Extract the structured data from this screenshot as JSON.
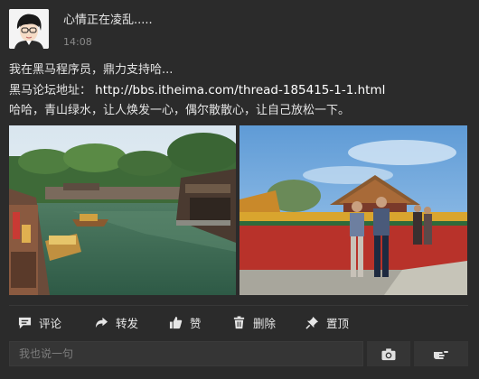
{
  "post": {
    "username": "心情正在凌乱.....",
    "time": "14:08",
    "line1": "我在黑马程序员，鼎力支持哈...",
    "line2_label": "黑马论坛地址：",
    "line2_url": "http://bbs.itheima.com/thread-185415-1-1.html",
    "line3": "哈哈，青山绿水，让人焕发一心，偶尔散散心，让自己放松一下。"
  },
  "actions": {
    "comment": "评论",
    "share": "转发",
    "like": "赞",
    "delete": "删除",
    "pin": "置顶"
  },
  "reply": {
    "placeholder": "我也说一句"
  }
}
